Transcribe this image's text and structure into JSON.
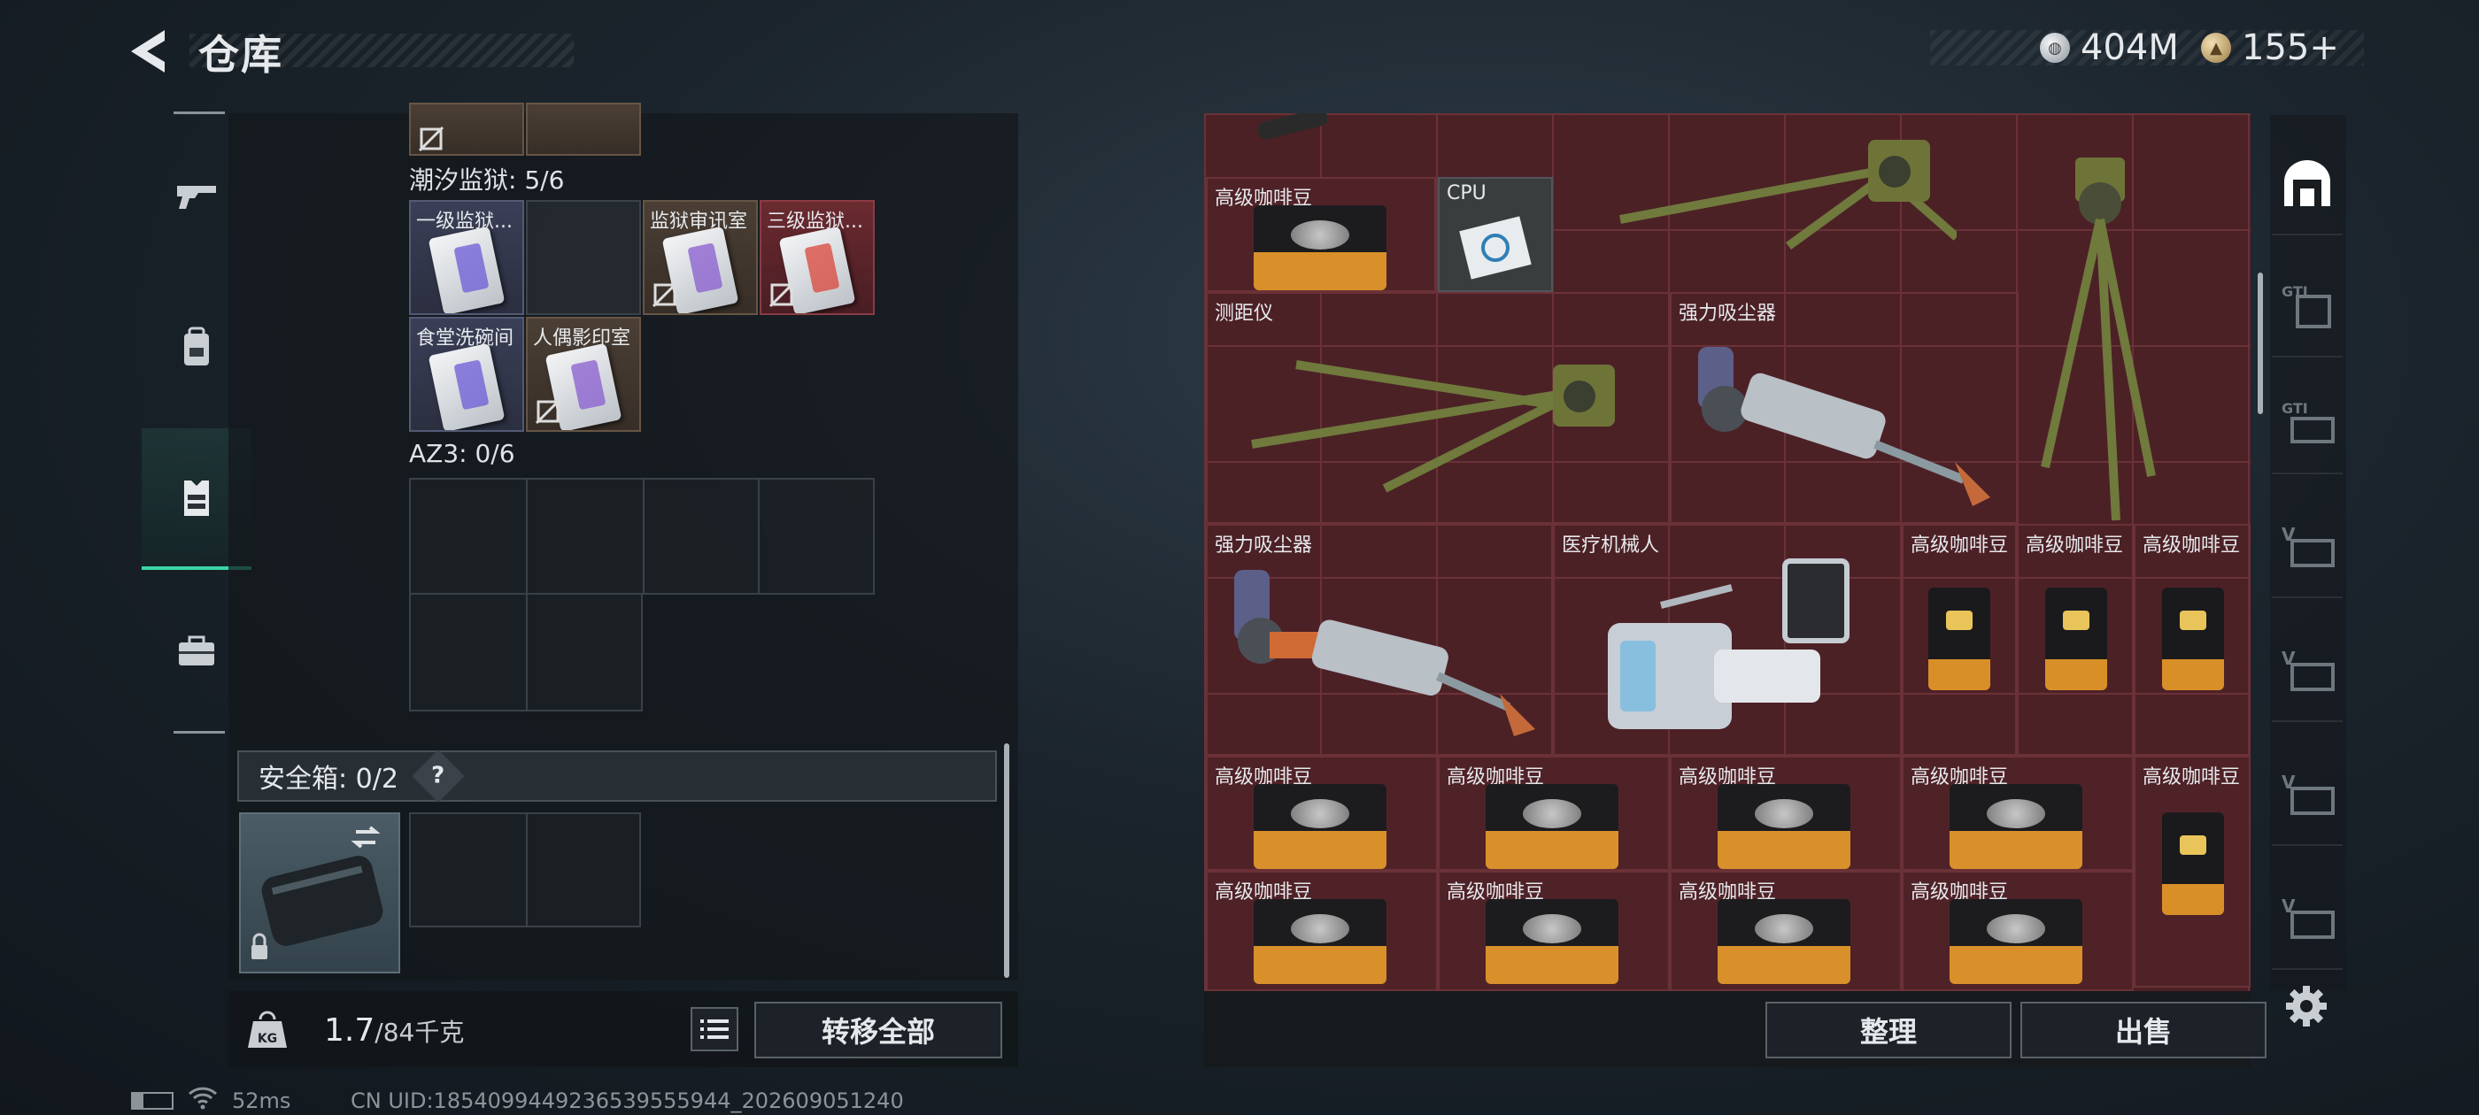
{
  "header": {
    "title": "仓库"
  },
  "currency": [
    {
      "icon": "silver-coin-icon",
      "value": "404M"
    },
    {
      "icon": "gold-coin-icon",
      "value": "155+"
    }
  ],
  "nav": [
    "gun-icon",
    "backpack-icon",
    "vest-icon",
    "briefcase-icon"
  ],
  "backpack": {
    "sections": [
      {
        "label": "潮汐监狱: 5/6",
        "slots": [
          {
            "label": "一级监狱...",
            "color": "purple",
            "stripe": "#6b5bd6",
            "linked": true
          },
          {
            "label": "",
            "color": "empty"
          },
          {
            "label": "监狱审讯室",
            "color": "brown",
            "stripe": "#8a5cd0",
            "linked": false
          },
          {
            "label": "三级监狱...",
            "color": "red",
            "stripe": "#d9453a",
            "linked": false
          },
          {
            "label": "食堂洗碗间",
            "color": "purple",
            "stripe": "#6b5bd6",
            "linked": true
          },
          {
            "label": "人偶影印室",
            "color": "brown",
            "stripe": "#8a5cd0",
            "linked": false
          }
        ]
      },
      {
        "label": "AZ3: 0/6"
      }
    ],
    "safebox": {
      "label": "安全箱: 0/2",
      "help": "?"
    }
  },
  "weight": {
    "current": "1.7",
    "max": "/84千克"
  },
  "buttons": {
    "transfer_all": "转移全部",
    "sort": "整理",
    "sell": "出售"
  },
  "stash_items": [
    {
      "label": "高级咖啡豆",
      "type": "coffee"
    },
    {
      "label": "CPU",
      "type": "cpu"
    },
    {
      "label": "测距仪",
      "type": "rangefinder"
    },
    {
      "label": "强力吸尘器",
      "type": "vacuum"
    },
    {
      "label": "强力吸尘器",
      "type": "vacuum"
    },
    {
      "label": "医疗机械人",
      "type": "medbot"
    },
    {
      "label": "高级咖啡豆",
      "type": "coffee"
    },
    {
      "label": "高级咖啡豆",
      "type": "coffee"
    },
    {
      "label": "高级咖啡豆",
      "type": "coffee"
    },
    {
      "label": "高级咖啡豆",
      "type": "coffee"
    },
    {
      "label": "高级咖啡豆",
      "type": "coffee"
    },
    {
      "label": "高级咖啡豆",
      "type": "coffee"
    },
    {
      "label": "高级咖啡豆",
      "type": "coffee"
    },
    {
      "label": "高级咖啡豆",
      "type": "coffee"
    },
    {
      "label": "高级咖啡豆",
      "type": "coffee"
    },
    {
      "label": "高级咖啡豆",
      "type": "coffee"
    },
    {
      "label": "高级咖啡豆",
      "type": "coffee"
    },
    {
      "label": "高级咖啡豆",
      "type": "coffee"
    }
  ],
  "right_tabs": [
    "home-icon",
    "gti-icon",
    "gti-icon",
    "v-icon",
    "v-icon",
    "v-icon",
    "v-icon"
  ],
  "status": {
    "ping": "52ms",
    "uid": "CN UID:1854099449236539555944_202609051240"
  }
}
